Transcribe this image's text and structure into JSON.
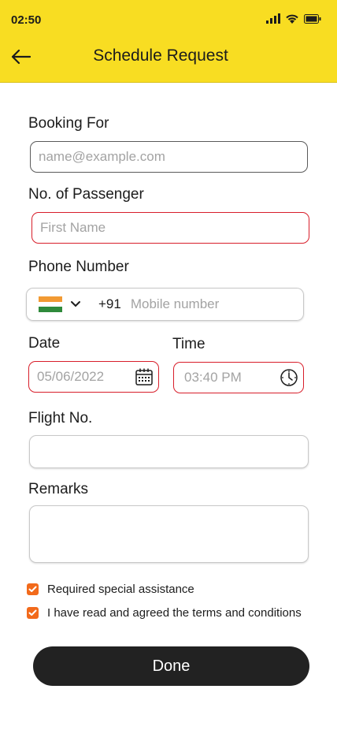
{
  "status_bar": {
    "time": "02:50"
  },
  "header": {
    "title": "Schedule Request"
  },
  "form": {
    "booking_for": {
      "label": "Booking For",
      "placeholder": "name@example.com",
      "value": ""
    },
    "passengers": {
      "label": "No. of Passenger",
      "placeholder": "First Name",
      "value": ""
    },
    "phone": {
      "label": "Phone Number",
      "dial_code": "+91",
      "placeholder": "Mobile number",
      "value": ""
    },
    "date": {
      "label": "Date",
      "value": "05/06/2022"
    },
    "time": {
      "label": "Time",
      "value": "03:40 PM"
    },
    "flight": {
      "label": "Flight No.",
      "value": ""
    },
    "remarks": {
      "label": "Remarks",
      "value": ""
    }
  },
  "checkboxes": [
    {
      "label": "Required special assistance",
      "checked": true
    },
    {
      "label": "I have read and agreed the terms and conditions",
      "checked": true
    }
  ],
  "done_label": "Done",
  "colors": {
    "header_bg": "#f8dd22",
    "error_border": "#d81e2a",
    "checkbox": "#f26a1b",
    "button_bg": "#222222"
  }
}
